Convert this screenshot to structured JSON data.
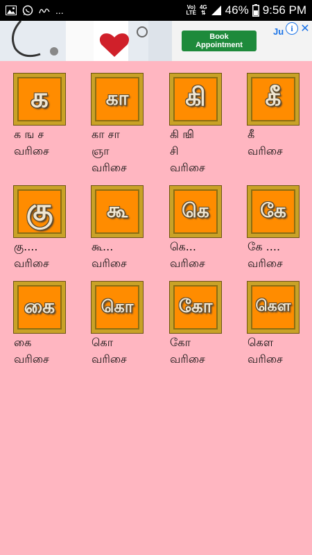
{
  "status_bar": {
    "network_top": "Vo)",
    "network_mid": "LTE",
    "network_type": "4G",
    "battery": "46%",
    "time": "9:56 PM",
    "notifications": [
      "image-icon",
      "whatsapp-icon",
      "signature-icon"
    ],
    "more": "..."
  },
  "ad": {
    "button_label": "Book Appointment",
    "brand_text": "Ju"
  },
  "tiles": [
    {
      "glyph": "க",
      "caption": "க ங ச\nவரிசை"
    },
    {
      "glyph": "கா",
      "caption": "கா சா\nஞா\nவரிசை"
    },
    {
      "glyph": "கி",
      "caption": "கி ஙி\nசி\nவரிசை"
    },
    {
      "glyph": "கீ",
      "caption": "கீ\nவரிசை"
    },
    {
      "glyph": "கு",
      "caption": "கு....\nவரிசை"
    },
    {
      "glyph": "கூ",
      "caption": "கூ...\nவரிசை"
    },
    {
      "glyph": "கெ",
      "caption": "கெ...\nவரிசை"
    },
    {
      "glyph": "கே",
      "caption": "கே ....\nவரிசை"
    },
    {
      "glyph": "கை",
      "caption": "கை\nவரிசை"
    },
    {
      "glyph": "கொ",
      "caption": "கொ\nவரிசை"
    },
    {
      "glyph": "கோ",
      "caption": "கோ\nவரிசை"
    },
    {
      "glyph": "கௌ",
      "caption": "கௌ\nவரிசை"
    }
  ]
}
